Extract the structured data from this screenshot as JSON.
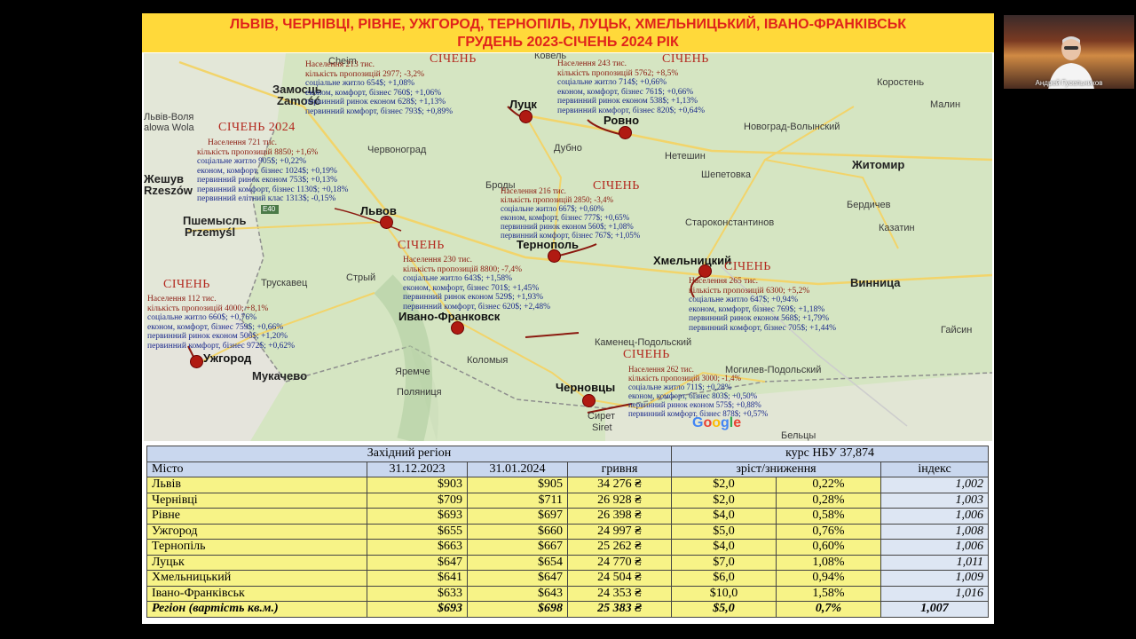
{
  "title": {
    "line1": "ЛЬВІВ, ЧЕРНІВЦІ, РІВНЕ, УЖГОРОД, ТЕРНОПІЛЬ, ЛУЦЬК, ХМЕЛЬНИЦЬКИЙ, ІВАНО-ФРАНКІВСЬК",
    "line2": "ГРУДЕНЬ 2023-СІЧЕНЬ 2024 РІК"
  },
  "webcam": {
    "name": "Андрей Гусельников"
  },
  "map": {
    "places": {
      "cheim": "Cheim",
      "kovel": "Ковель",
      "zamosc1": "Замосць",
      "zamosc2": "Zamość",
      "volia1": "Львів-Воля",
      "volia2": "alowa Wola",
      "chervonograd": "Червоноград",
      "zheshuv": "Жешув",
      "rzeszow": "Rzeszów",
      "e40": "E40",
      "peremyshl": "Пшемысль",
      "przemysl": "Przemyśl",
      "truskavets": "Трускавец",
      "stryi": "Стрый",
      "mukachevo": "Мукачево",
      "yaremche": "Яремче",
      "kolomyia": "Коломыя",
      "polianytsia": "Поляниця",
      "brody": "Броды",
      "dubno": "Дубно",
      "netishyn": "Нетешин",
      "shepetovka": "Шепетовка",
      "starokonstantinov": "Староконстантинов",
      "kamenets": "Каменец-Подольский",
      "mogilev": "Могилев-Подольский",
      "siret1": "Сирет",
      "siret2": "Siret",
      "beltsy": "Бельцы",
      "korosten": "Коростень",
      "malin": "Малин",
      "novograd": "Новоград-Волынский",
      "zhitomir": "Житомир",
      "berdichev": "Бердичев",
      "kazatin": "Казатин",
      "vinnitsa": "Винница",
      "gaysin": "Гайсин"
    },
    "cities": {
      "lutsk": "Луцк",
      "rovno": "Ровно",
      "lvov": "Львов",
      "ternopol": "Тернополь",
      "khmelnitsky": "Хмельницкий",
      "ivanofrankovsk": "Ивано-Франковск",
      "uzhgorod": "Ужгород",
      "chernovtsy": "Черновцы"
    },
    "google": "Google",
    "annotations": {
      "lutsk": {
        "jan": "СІЧЕНЬ",
        "lines": [
          "Населення 213 тис.",
          "кількість пропозицій 2977; -3,2%",
          "соцiальне житло 654$; +1,08%",
          "економ, комфорт, бізнес 760$; +1,06%",
          "первинний ринок економ 628$; +1,13%",
          "первинний комфорт, бізнес 793$; +0,89%"
        ]
      },
      "rovno": {
        "jan": "СІЧЕНЬ",
        "lines": [
          "Населення 243 тис.",
          "кількість пропозицій 5762; +8,5%",
          "соцiальне житло 714$; +0,66%",
          "економ, комфорт, бізнес 761$; +0,66%",
          "первинний ринок економ 538$; +1,13%",
          "первинний комфорт, бізнес 820$; +0,64%"
        ]
      },
      "lvov": {
        "jan": "СІЧЕНЬ 2024",
        "lines": [
          "Населення 721 тис.",
          "кількість пропозицій 8850; +1,6%",
          "соцiальне житло 905$; +0,22%",
          "економ, комфорт, бізнес 1024$; +0,19%",
          "первинний ринок економ 753$; +0,13%",
          "первинний комфорт, бізнес 1130$; +0,18%",
          "первинний елітний клас 1313$; -0,15%"
        ]
      },
      "ternopol": {
        "jan": "СІЧЕНЬ",
        "lines": [
          "Населення 216 тис.",
          "кількість пропозицій 2850; -3,4%",
          "соцiальне житло 667$; +0,60%",
          "економ, комфорт, бізнес 777$; +0,65%",
          "первинний ринок економ 560$; +1,08%",
          "первинний комфорт, бізнес 767$; +1,05%"
        ]
      },
      "ivanofrankovsk": {
        "jan": "СІЧЕНЬ",
        "lines": [
          "Населення 230 тис.",
          "кількість пропозицій 8800; -7,4%",
          "соцiальне житло 643$; +1,58%",
          "економ, комфорт, бізнес 701$; +1,45%",
          "первинний ринок економ 529$; +1,93%",
          "первинний комфорт, бізнес 620$; +2,48%"
        ]
      },
      "khmelnitsky": {
        "jan": "СІЧЕНЬ",
        "lines": [
          "Населення 265 тис.",
          "кількість пропозицій 6300; +5,2%",
          "соцiальне житло 647$; +0,94%",
          "економ, комфорт, бізнес 769$; +1,18%",
          "первинний ринок економ 568$; +1,79%",
          "первинний комфорт, бізнес 705$; +1,44%"
        ]
      },
      "uzhgorod": {
        "jan": "СІЧЕНЬ",
        "lines": [
          "Населення 112 тис.",
          "кількість пропозицій 4000; +8,1%",
          "соцiальне житло 660$; +0,76%",
          "економ, комфорт, бізнес 759$; +0,66%",
          "первинний ринок економ 506$; +1,20%",
          "первинний комфорт, бізнес 972$; +0,62%"
        ]
      },
      "chernovtsy": {
        "jan": "СІЧЕНЬ",
        "lines": [
          "Населення 262 тис.",
          "кількість пропозицій 3000; -1,4%",
          "соцiальне житло 711$; +0,28%",
          "економ, комфорт, бізнес 803$; +0,50%",
          "первинний ринок економ 575$; +0,88%",
          "первинний комфорт, бізнес 878$; +0,57%"
        ]
      }
    }
  },
  "table": {
    "region_header": "Західний регіон",
    "rate_header": "курс НБУ 37,874",
    "columns": [
      "Місто",
      "31.12.2023",
      "31.01.2024",
      "гривня",
      "зріст/зниження",
      "індекс"
    ],
    "rows": [
      [
        "Львів",
        "$903",
        "$905",
        "34 276 ₴",
        "$2,0",
        "0,22%",
        "1,002"
      ],
      [
        "Чернівці",
        "$709",
        "$711",
        "26 928 ₴",
        "$2,0",
        "0,28%",
        "1,003"
      ],
      [
        "Рівне",
        "$693",
        "$697",
        "26 398 ₴",
        "$4,0",
        "0,58%",
        "1,006"
      ],
      [
        "Ужгород",
        "$655",
        "$660",
        "24 997 ₴",
        "$5,0",
        "0,76%",
        "1,008"
      ],
      [
        "Тернопіль",
        "$663",
        "$667",
        "25 262 ₴",
        "$4,0",
        "0,60%",
        "1,006"
      ],
      [
        "Луцьк",
        "$647",
        "$654",
        "24 770 ₴",
        "$7,0",
        "1,08%",
        "1,011"
      ],
      [
        "Хмельницький",
        "$641",
        "$647",
        "24 504 ₴",
        "$6,0",
        "0,94%",
        "1,009"
      ],
      [
        "Івано-Франківськ",
        "$633",
        "$643",
        "24 353 ₴",
        "$10,0",
        "1,58%",
        "1,016"
      ]
    ],
    "total": [
      "Регіон (вартість кв.м.)",
      "$693",
      "$698",
      "25 383 ₴",
      "$5,0",
      "0,7%",
      "1,007"
    ]
  }
}
